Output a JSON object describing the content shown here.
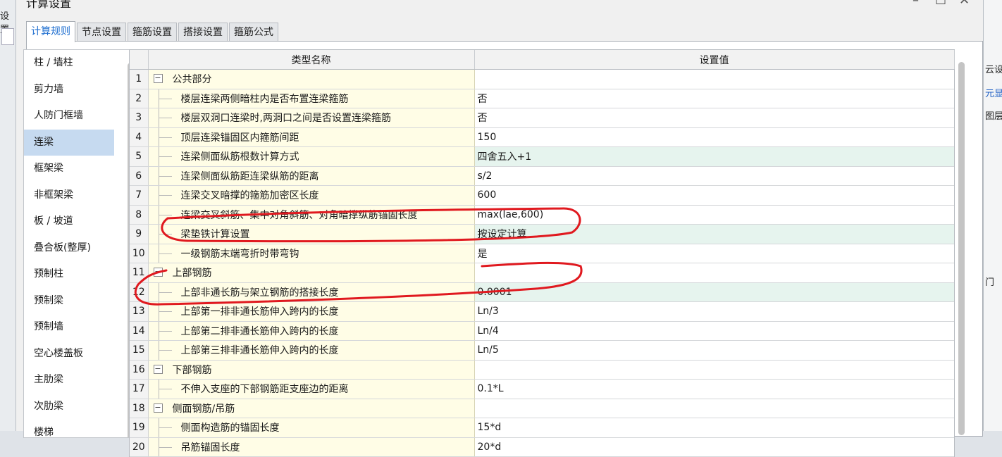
{
  "window": {
    "title": "计算设置",
    "controls": {
      "minimize": "–",
      "maximize": "☐",
      "close": "✕"
    }
  },
  "background": {
    "left_labels": [
      "设置",
      "圆"
    ],
    "right_labels": [
      "云设",
      "元显",
      "图层",
      "门"
    ]
  },
  "tabs": [
    {
      "label": "计算规则",
      "active": true
    },
    {
      "label": "节点设置",
      "active": false
    },
    {
      "label": "箍筋设置",
      "active": false
    },
    {
      "label": "搭接设置",
      "active": false
    },
    {
      "label": "箍筋公式",
      "active": false
    }
  ],
  "categories": [
    {
      "label": "柱 / 墙柱",
      "active": false
    },
    {
      "label": "剪力墙",
      "active": false
    },
    {
      "label": "人防门框墙",
      "active": false
    },
    {
      "label": "连梁",
      "active": true
    },
    {
      "label": "框架梁",
      "active": false
    },
    {
      "label": "非框架梁",
      "active": false
    },
    {
      "label": "板 / 坡道",
      "active": false
    },
    {
      "label": "叠合板(整厚)",
      "active": false
    },
    {
      "label": "预制柱",
      "active": false
    },
    {
      "label": "预制梁",
      "active": false
    },
    {
      "label": "预制墙",
      "active": false
    },
    {
      "label": "空心楼盖板",
      "active": false
    },
    {
      "label": "主肋梁",
      "active": false
    },
    {
      "label": "次肋梁",
      "active": false
    },
    {
      "label": "楼梯",
      "active": false
    }
  ],
  "grid": {
    "columns": {
      "name": "类型名称",
      "value": "设置值"
    },
    "rows": [
      {
        "num": "1",
        "group": true,
        "name": "公共部分",
        "value": ""
      },
      {
        "num": "2",
        "name": "楼层连梁两侧暗柱内是否布置连梁箍筋",
        "value": "否"
      },
      {
        "num": "3",
        "name": "楼层双洞口连梁时,两洞口之间是否设置连梁箍筋",
        "value": "否"
      },
      {
        "num": "4",
        "name": "顶层连梁锚固区内箍筋间距",
        "value": "150"
      },
      {
        "num": "5",
        "name": "连梁侧面纵筋根数计算方式",
        "value": "四舍五入+1",
        "highlight": true
      },
      {
        "num": "6",
        "name": "连梁侧面纵筋距连梁纵筋的距离",
        "value": "s/2"
      },
      {
        "num": "7",
        "name": "连梁交叉暗撑的箍筋加密区长度",
        "value": "600"
      },
      {
        "num": "8",
        "name": "连梁交叉斜筋、集中对角斜筋、对角暗撑纵筋锚固长度",
        "value": "max(lae,600)"
      },
      {
        "num": "9",
        "name": "梁垫铁计算设置",
        "value": "按设定计算",
        "highlight": true
      },
      {
        "num": "10",
        "name": "一级钢筋末端弯折时带弯钩",
        "value": "是"
      },
      {
        "num": "11",
        "group": true,
        "name": "上部钢筋",
        "value": ""
      },
      {
        "num": "12",
        "name": "上部非通长筋与架立钢筋的搭接长度",
        "value": "0.0001",
        "highlight": true
      },
      {
        "num": "13",
        "name": "上部第一排非通长筋伸入跨内的长度",
        "value": "Ln/3"
      },
      {
        "num": "14",
        "name": "上部第二排非通长筋伸入跨内的长度",
        "value": "Ln/4"
      },
      {
        "num": "15",
        "name": "上部第三排非通长筋伸入跨内的长度",
        "value": "Ln/5"
      },
      {
        "num": "16",
        "group": true,
        "name": "下部钢筋",
        "value": ""
      },
      {
        "num": "17",
        "name": "不伸入支座的下部钢筋距支座边的距离",
        "value": "0.1*L"
      },
      {
        "num": "18",
        "group": true,
        "name": "侧面钢筋/吊筋",
        "value": ""
      },
      {
        "num": "19",
        "name": "侧面构造筋的锚固长度",
        "value": "15*d"
      },
      {
        "num": "20",
        "name": "吊筋锚固长度",
        "value": "20*d"
      }
    ]
  },
  "colors": {
    "annotation_red": "#e0191f",
    "highlight_row": "#e6f4ee",
    "name_column_bg": "#fffde6",
    "active_tab_text": "#1f6fd0",
    "active_category_bg": "#c6daf0"
  }
}
